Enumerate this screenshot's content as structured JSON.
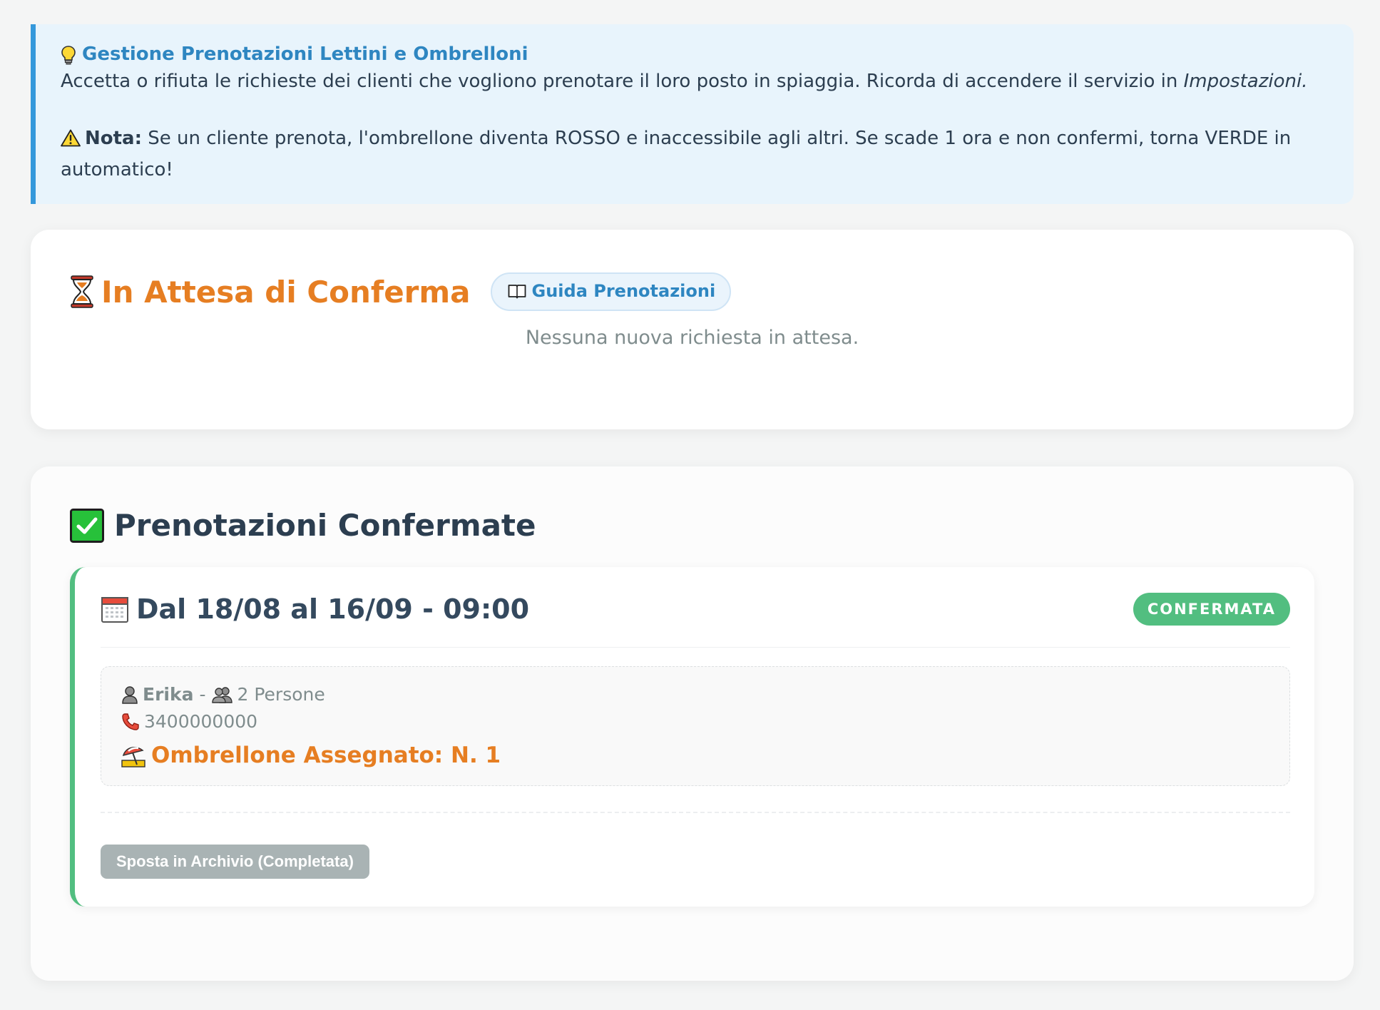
{
  "info": {
    "title": "Gestione Prenotazioni Lettini e Ombrelloni",
    "text_main": "Accetta o rifiuta le richieste dei clienti che vogliono prenotare il loro posto in spiaggia. Ricorda di accendere il servizio in ",
    "text_link": "Impostazioni.",
    "note_label": "Nota:",
    "note_text": " Se un cliente prenota, l'ombrellone diventa ROSSO e inaccessibile agli altri. Se scade 1 ora e non confermi, torna VERDE in automatico!"
  },
  "pending": {
    "title": "In Attesa di Conferma",
    "guide_button": "Guida Prenotazioni",
    "empty_message": "Nessuna nuova richiesta in attesa."
  },
  "confirmed": {
    "title": "Prenotazioni Confermate",
    "bookings": [
      {
        "date_range": "Dal 18/08 al 16/09 - 09:00",
        "status": "CONFERMATA",
        "customer_name": "Erika",
        "separator": "-",
        "people": "2 Persone",
        "phone": "3400000000",
        "umbrella": "Ombrellone Assegnato: N. 1",
        "archive_button": "Sposta in Archivio (Completata)"
      }
    ]
  },
  "colors": {
    "info_accent": "#3498db",
    "pending_title": "#e67e22",
    "confirmed_accent": "#52be80",
    "archive_button": "#a9b3b4"
  },
  "icons": {
    "info": "lightbulb-icon",
    "warning": "warning-icon",
    "pending": "hourglass-icon",
    "guide": "book-icon",
    "confirmed": "checkmark-box-icon",
    "date": "calendar-icon",
    "person": "person-icon",
    "people": "people-icon",
    "phone": "phone-icon",
    "umbrella": "beach-umbrella-icon"
  }
}
